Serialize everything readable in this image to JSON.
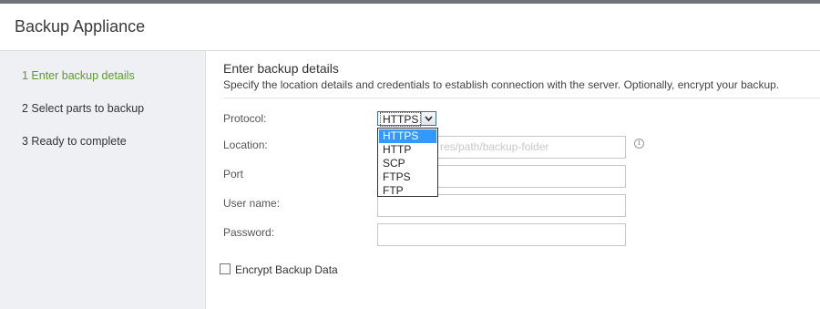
{
  "window": {
    "title": "Backup Appliance"
  },
  "sidebar": {
    "steps": [
      {
        "label": "1 Enter backup details",
        "active": true
      },
      {
        "label": "2 Select parts to backup",
        "active": false
      },
      {
        "label": "3 Ready to complete",
        "active": false
      }
    ]
  },
  "main": {
    "heading": "Enter backup details",
    "description": "Specify the location details and credentials to establish connection with the server. Optionally, encrypt your backup."
  },
  "form": {
    "protocol_label": "Protocol:",
    "protocol_value": "HTTPS",
    "protocol_options": [
      "HTTPS",
      "HTTP",
      "SCP",
      "FTPS",
      "FTP"
    ],
    "location_label": "Location:",
    "location_placeholder_visible": "res/path/backup-folder",
    "port_label": "Port",
    "username_label": "User name:",
    "password_label": "Password:",
    "encrypt_label": "Encrypt Backup Data",
    "encrypt_checked": false
  },
  "icons": {
    "dropdown_arrow": "chevron-down-icon",
    "info": "info-icon"
  },
  "colors": {
    "active_step": "#5a9e2a",
    "option_highlight": "#3399ff"
  }
}
